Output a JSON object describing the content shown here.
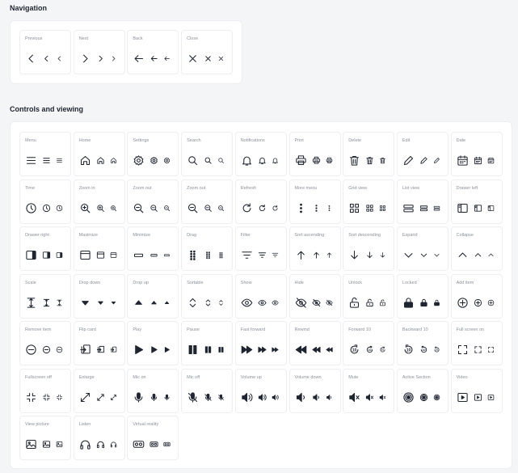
{
  "sections": [
    {
      "title": "Navigation",
      "items": [
        {
          "label": "Previous",
          "icon": "chevron-left-icon"
        },
        {
          "label": "Next",
          "icon": "chevron-right-icon"
        },
        {
          "label": "Back",
          "icon": "arrow-left-icon"
        },
        {
          "label": "Close",
          "icon": "close-icon"
        }
      ]
    },
    {
      "title": "Controls and viewing",
      "items": [
        {
          "label": "Menu",
          "icon": "menu-icon"
        },
        {
          "label": "Home",
          "icon": "home-icon"
        },
        {
          "label": "Settings",
          "icon": "gear-icon"
        },
        {
          "label": "Search",
          "icon": "search-icon"
        },
        {
          "label": "Notifications",
          "icon": "bell-icon"
        },
        {
          "label": "Print",
          "icon": "printer-icon"
        },
        {
          "label": "Delete",
          "icon": "trash-icon"
        },
        {
          "label": "Edit",
          "icon": "pencil-icon"
        },
        {
          "label": "Date",
          "icon": "calendar-icon"
        },
        {
          "label": "Time",
          "icon": "clock-icon"
        },
        {
          "label": "Zoom in",
          "icon": "zoom-in-icon"
        },
        {
          "label": "Zoom out",
          "icon": "zoom-out-icon"
        },
        {
          "label": "Zoom out",
          "icon": "zoom-out-icon"
        },
        {
          "label": "Refresh",
          "icon": "refresh-icon"
        },
        {
          "label": "More menu",
          "icon": "more-vertical-icon"
        },
        {
          "label": "Grid view",
          "icon": "grid-view-icon"
        },
        {
          "label": "List view",
          "icon": "list-view-icon"
        },
        {
          "label": "Drawer left",
          "icon": "drawer-left-icon"
        },
        {
          "label": "Drawer right",
          "icon": "drawer-right-icon"
        },
        {
          "label": "Maximize",
          "icon": "maximize-icon"
        },
        {
          "label": "Minimize",
          "icon": "minimize-icon"
        },
        {
          "label": "Drag",
          "icon": "drag-handle-icon"
        },
        {
          "label": "Filter",
          "icon": "filter-icon"
        },
        {
          "label": "Sort ascending",
          "icon": "sort-ascending-icon"
        },
        {
          "label": "Sort descending",
          "icon": "sort-descending-icon"
        },
        {
          "label": "Expand",
          "icon": "chevron-down-icon"
        },
        {
          "label": "Collapse",
          "icon": "chevron-up-icon"
        },
        {
          "label": "Scale",
          "icon": "scale-icon"
        },
        {
          "label": "Drop down",
          "icon": "caret-down-icon"
        },
        {
          "label": "Drop up",
          "icon": "caret-up-icon"
        },
        {
          "label": "Sortable",
          "icon": "sortable-icon"
        },
        {
          "label": "Show",
          "icon": "eye-icon"
        },
        {
          "label": "Hide",
          "icon": "eye-off-icon"
        },
        {
          "label": "Unlock",
          "icon": "unlock-icon"
        },
        {
          "label": "Locked",
          "icon": "lock-icon"
        },
        {
          "label": "Add item",
          "icon": "add-circle-icon"
        },
        {
          "label": "Remove item",
          "icon": "remove-circle-icon"
        },
        {
          "label": "Flip card",
          "icon": "flip-card-icon"
        },
        {
          "label": "Play",
          "icon": "play-icon"
        },
        {
          "label": "Pause",
          "icon": "pause-icon"
        },
        {
          "label": "Fast forward",
          "icon": "fast-forward-icon"
        },
        {
          "label": "Rewind",
          "icon": "rewind-icon"
        },
        {
          "label": "Forward 10",
          "icon": "forward-10-icon"
        },
        {
          "label": "Backward 10",
          "icon": "backward-10-icon"
        },
        {
          "label": "Full screen on",
          "icon": "fullscreen-on-icon"
        },
        {
          "label": "Fullscreen off",
          "icon": "fullscreen-off-icon"
        },
        {
          "label": "Enlarge",
          "icon": "enlarge-icon"
        },
        {
          "label": "Mic on",
          "icon": "mic-icon"
        },
        {
          "label": "Mic off",
          "icon": "mic-off-icon"
        },
        {
          "label": "Volume up",
          "icon": "volume-up-icon"
        },
        {
          "label": "Volume down",
          "icon": "volume-down-icon"
        },
        {
          "label": "Mute",
          "icon": "mute-icon"
        },
        {
          "label": "Active Section",
          "icon": "active-section-icon"
        },
        {
          "label": "Video",
          "icon": "video-icon"
        },
        {
          "label": "View picture",
          "icon": "image-icon"
        },
        {
          "label": "Listen",
          "icon": "headphones-icon"
        },
        {
          "label": "Virtual reality",
          "icon": "vr-headset-icon"
        }
      ]
    }
  ],
  "colors": {
    "page": "#f4f5f7",
    "panel": "#ffffff",
    "border": "#eceef2",
    "label": "#8a909b",
    "icon": "#1e2430"
  }
}
